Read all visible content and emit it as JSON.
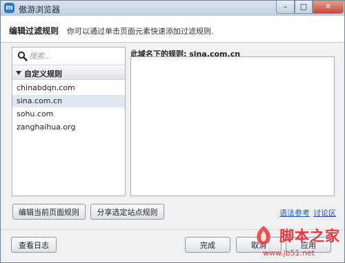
{
  "window": {
    "title": "傲游浏览器"
  },
  "header": {
    "title": "编辑过滤规则",
    "description": "你可以通过单击页面元素快速添加过滤规则."
  },
  "search": {
    "placeholder": "搜索..."
  },
  "rules": {
    "group_label": "自定义规则",
    "items": [
      {
        "label": "chinabdqn.com"
      },
      {
        "label": "sina.com.cn"
      },
      {
        "label": "sohu.com"
      },
      {
        "label": "zanghaihua.org"
      }
    ],
    "selected_index": 1
  },
  "detail": {
    "label": "此域名下的规则: sina.com.cn"
  },
  "actions": {
    "edit_label": "编辑当前页面规则",
    "share_label": "分享选定站点规则",
    "syntax_link": "语法参考",
    "discuss_link": "讨论区"
  },
  "footer": {
    "log_label": "查看日志",
    "done_label": "完成",
    "cancel_label": "取消",
    "apply_label": "应用"
  },
  "watermark": {
    "text": "脚本之家",
    "url": "www.jb51.net"
  },
  "colors": {
    "accent": "#1f56a8",
    "selection": "#dfe7f1",
    "watermark": "#e8363a"
  }
}
